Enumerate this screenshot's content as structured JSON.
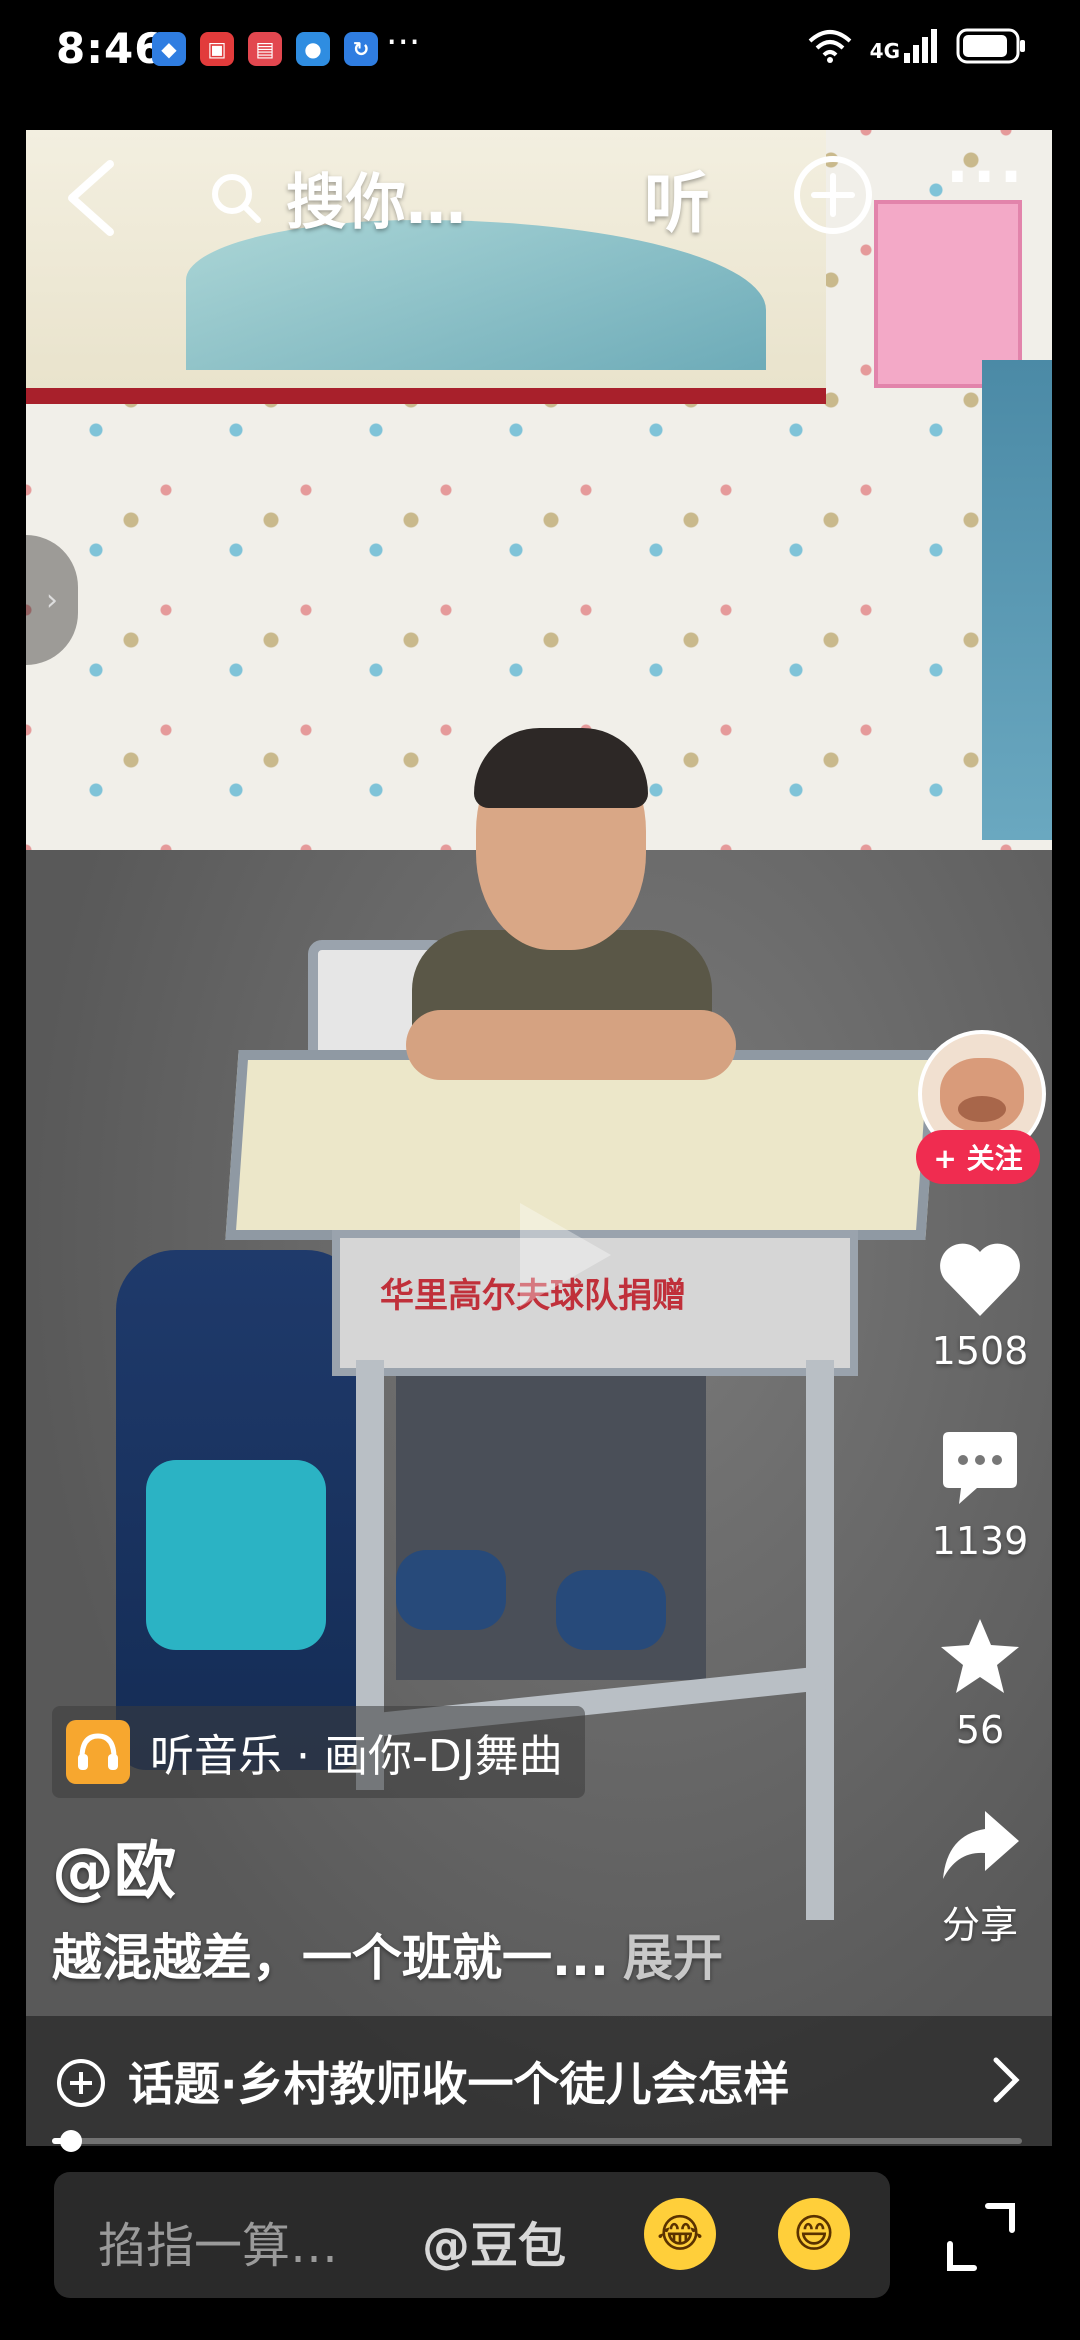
{
  "status_bar": {
    "time": "8:46",
    "notification_more": "···",
    "network": "4G"
  },
  "top_bar": {
    "search_text": "搜你…",
    "listen_label": "听"
  },
  "video": {
    "desk_sign": "华里高尔夫球队捐赠"
  },
  "side_rail": {
    "follow_label": "+ 关注",
    "likes": "1508",
    "comments": "1139",
    "favorites": "56",
    "share_label": "分享"
  },
  "music": {
    "label": "听音乐 · 画你-DJ舞曲"
  },
  "post": {
    "author": "@欧",
    "description": "越混越差，一个班就一...",
    "expand_label": "展开",
    "topic": "话题·乡村教师收一个徒儿会怎样"
  },
  "playback": {
    "progress": 0.02
  },
  "comment_bar": {
    "placeholder": "掐指一算…",
    "mention": "@豆包",
    "emoji_1": "crying-laughing-emoji",
    "emoji_2": "grinning-emoji"
  },
  "colors": {
    "follow_red": "#f02c50",
    "music_orange": "#f7a72f"
  }
}
